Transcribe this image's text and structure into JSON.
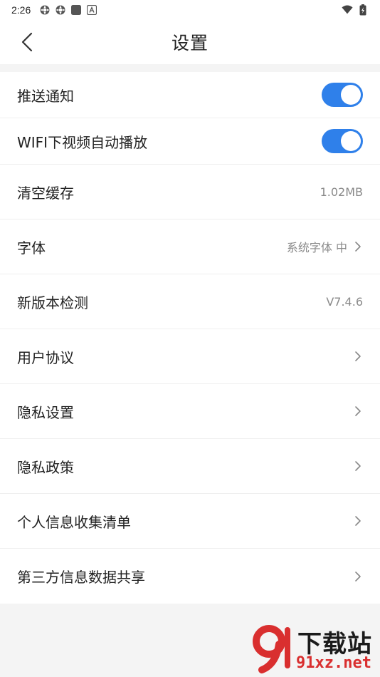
{
  "status_bar": {
    "time": "2:26",
    "left_icons": [
      "settings-gear-icon",
      "settings-gear-icon",
      "square-app-icon",
      "font-a-icon"
    ],
    "right_icons": [
      "wifi-icon",
      "battery-charging-icon"
    ]
  },
  "header": {
    "title": "设置",
    "back_icon": "chevron-left-icon"
  },
  "settings": {
    "items": [
      {
        "label": "推送通知",
        "type": "toggle",
        "on": true
      },
      {
        "label": "WIFI下视频自动播放",
        "type": "toggle",
        "on": true
      },
      {
        "label": "清空缓存",
        "type": "value",
        "value": "1.02MB"
      },
      {
        "label": "字体",
        "type": "value-chevron",
        "value": "系统字体 中"
      },
      {
        "label": "新版本检测",
        "type": "value",
        "value": "V7.4.6"
      },
      {
        "label": "用户协议",
        "type": "chevron"
      },
      {
        "label": "隐私设置",
        "type": "chevron"
      },
      {
        "label": "隐私政策",
        "type": "chevron"
      },
      {
        "label": "个人信息收集清单",
        "type": "chevron"
      },
      {
        "label": "第三方信息数据共享",
        "type": "chevron"
      }
    ]
  },
  "watermark": {
    "brand": "下载站",
    "domain": "91xz.net"
  },
  "colors": {
    "accent": "#2f80ea",
    "background": "#f4f4f4",
    "surface": "#ffffff",
    "text": "#222222",
    "secondary_text": "#8a8a8a",
    "watermark_red": "#d92f2f"
  }
}
